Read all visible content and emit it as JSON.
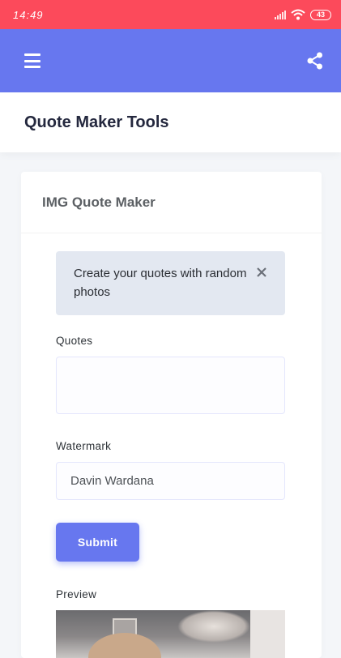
{
  "status_bar": {
    "time": "14:49",
    "battery": "43"
  },
  "app_bar": {
    "menu_icon": "hamburger-menu-icon",
    "share_icon": "share-icon",
    "color": "#6777ef"
  },
  "page": {
    "title": "Quote Maker Tools"
  },
  "card": {
    "title": "IMG Quote Maker",
    "alert": {
      "message": "Create your quotes with random photos",
      "close_icon": "close-icon"
    },
    "quotes": {
      "label": "Quotes",
      "value": ""
    },
    "watermark": {
      "label": "Watermark",
      "value": "Davin Wardana"
    },
    "submit_label": "Submit",
    "preview_label": "Preview"
  }
}
